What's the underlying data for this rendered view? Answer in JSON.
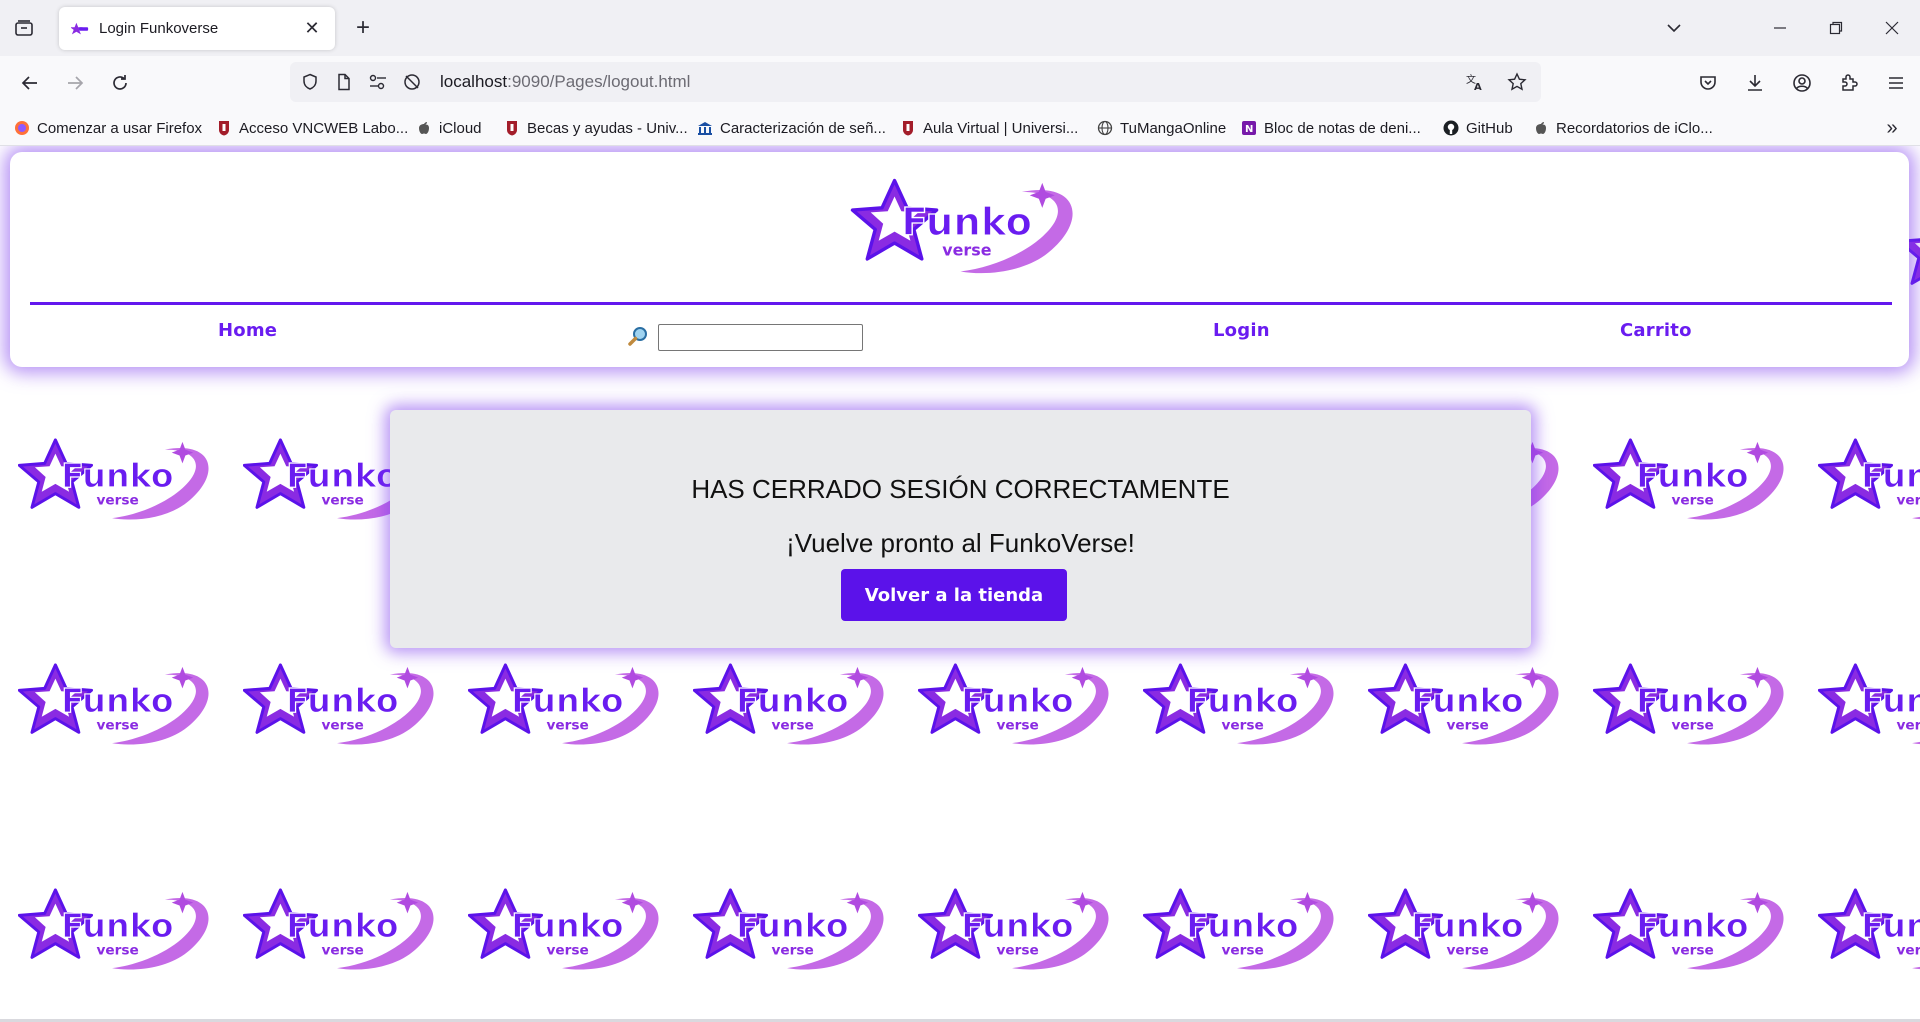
{
  "browser": {
    "tab": {
      "title": "Login Funkoverse"
    },
    "url": {
      "host": "localhost",
      "rest": ":9090/Pages/logout.html"
    },
    "bookmarks": [
      {
        "label": "Comenzar a usar Firefox",
        "icon": "firefox-icon"
      },
      {
        "label": "Acceso VNCWEB Labo...",
        "icon": "university-shield-icon"
      },
      {
        "label": "iCloud",
        "icon": "apple-icon"
      },
      {
        "label": "Becas y ayudas - Univ...",
        "icon": "university-shield-icon"
      },
      {
        "label": "Caracterización de señ...",
        "icon": "institution-icon"
      },
      {
        "label": "Aula Virtual | Universi...",
        "icon": "university-shield-icon"
      },
      {
        "label": "TuMangaOnline",
        "icon": "globe-icon"
      },
      {
        "label": "Bloc de notas de deni...",
        "icon": "onenote-icon"
      },
      {
        "label": "GitHub",
        "icon": "github-icon"
      },
      {
        "label": "Recordatorios de iClo...",
        "icon": "apple-icon"
      }
    ]
  },
  "page": {
    "logo_text": {
      "main": "Funko",
      "sub": "verse"
    },
    "menu": {
      "home": "Home",
      "login": "Login",
      "cart": "Carrito"
    },
    "search": {
      "value": ""
    },
    "message": {
      "title": "HAS CERRADO SESIÓN CORRECTAMENTE",
      "subtitle": "¡Vuelve pronto al FunkoVerse!",
      "button": "Volver a la tienda"
    }
  },
  "colors": {
    "brand_purple": "#6a1cf0",
    "button_purple": "#5b12ea",
    "glow": "#7c3aed",
    "card_gray": "#e9eaec"
  }
}
